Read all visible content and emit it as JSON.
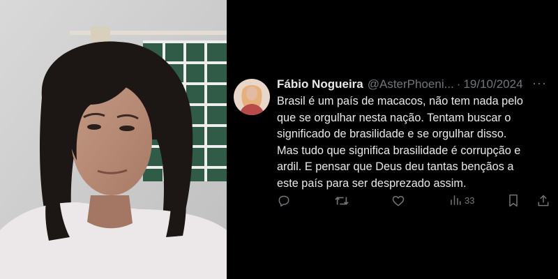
{
  "tweet": {
    "display_name": "Fábio Nogueira",
    "handle": "@AsterPhoeni...",
    "separator": "·",
    "date": "19/10/2024",
    "text_lines": [
      "Brasil é um país de macacos, não tem nada pelo",
      "que se orgulhar nesta nação. Tentam buscar o",
      "significado de brasilidade e se orgulhar disso.",
      "Mas tudo que significa brasilidade é corrupção e",
      "ardil. E pensar que Deus deu tantas bençãos a",
      "este país para ser desprezado assim."
    ],
    "more_label": "···",
    "views": "33"
  },
  "icons": {
    "reply": "reply-icon",
    "retweet": "retweet-icon",
    "like": "like-icon",
    "views": "views-icon",
    "bookmark": "bookmark-icon",
    "share": "share-icon"
  },
  "colors": {
    "background": "#000000",
    "primary_text": "#e7e9ea",
    "secondary_text": "#71767b"
  }
}
